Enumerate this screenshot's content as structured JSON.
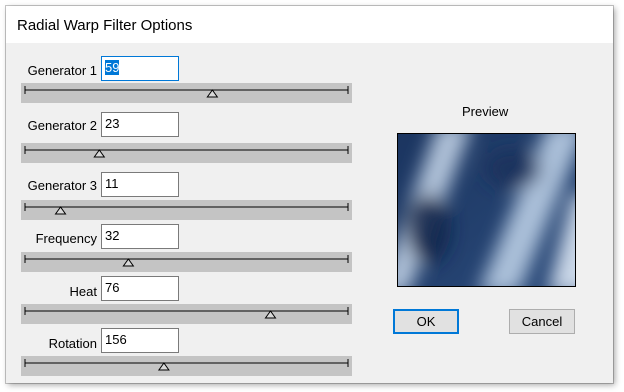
{
  "window": {
    "title": "Radial Warp Filter Options"
  },
  "sliders": [
    {
      "label": "Generator 1",
      "value": "59",
      "fraction": 0.58,
      "focused": true
    },
    {
      "label": "Generator 2",
      "value": "23",
      "fraction": 0.23,
      "focused": false
    },
    {
      "label": "Generator 3",
      "value": "11",
      "fraction": 0.11,
      "focused": false
    },
    {
      "label": "Frequency",
      "value": "32",
      "fraction": 0.32,
      "focused": false
    },
    {
      "label": "Heat",
      "value": "76",
      "fraction": 0.76,
      "focused": false
    },
    {
      "label": "Rotation",
      "value": "156",
      "fraction": 0.43,
      "focused": false
    }
  ],
  "preview": {
    "label": "Preview"
  },
  "buttons": {
    "ok": "OK",
    "cancel": "Cancel"
  }
}
